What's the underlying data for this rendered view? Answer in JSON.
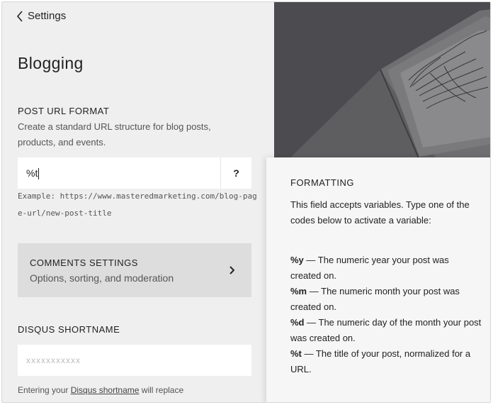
{
  "nav": {
    "back_label": "Settings"
  },
  "page": {
    "title": "Blogging"
  },
  "post_url_format": {
    "label": "POST URL FORMAT",
    "help": "Create a standard URL structure for blog posts, products, and events.",
    "value": "%t",
    "help_button": "?",
    "example": "Example: https://www.masteredmarketing.com/blog-page-url/new-post-title"
  },
  "comments_settings": {
    "title": "COMMENTS SETTINGS",
    "subtitle": "Options, sorting, and moderation"
  },
  "disqus": {
    "label": "DISQUS SHORTNAME",
    "placeholder": "xxxxxxxxxxx",
    "note_prefix": "Entering your",
    "note_link": "Disqus shortname",
    "note_suffix": "will replace"
  },
  "formatting": {
    "title": "FORMATTING",
    "intro": "This field accepts variables. Type one of the codes below to activate a variable:",
    "variables": [
      {
        "code": "%y",
        "desc": "— The numeric year your post was created on."
      },
      {
        "code": "%m",
        "desc": "— The numeric month your post was created on."
      },
      {
        "code": "%d",
        "desc": "— The numeric day of the month your post was created on."
      },
      {
        "code": "%t",
        "desc": "— The title of your post, normalized for a URL."
      }
    ]
  },
  "colors": {
    "panel_bg": "#efefef",
    "card_bg": "#dddddd",
    "popover_bg": "#f6f6f6",
    "text": "#222222"
  },
  "icons": {
    "back": "chevron-left-icon",
    "comments": "chevron-right-icon"
  }
}
